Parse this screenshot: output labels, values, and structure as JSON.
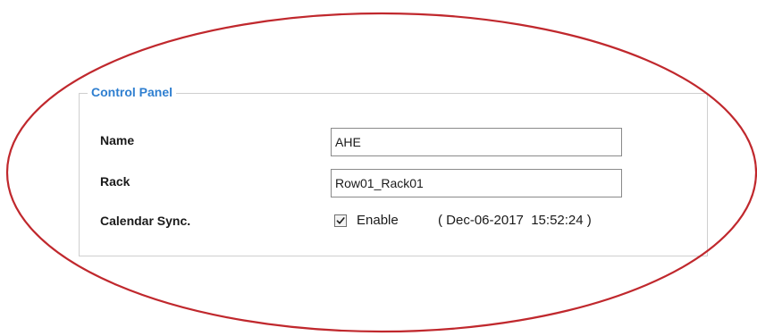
{
  "panel": {
    "legend": "Control Panel",
    "fields": [
      {
        "label": "Name",
        "value": "AHE"
      },
      {
        "label": "Rack",
        "value": "Row01_Rack01"
      }
    ],
    "calendar_sync": {
      "label": "Calendar Sync.",
      "checkbox_checked": true,
      "checkbox_label": "Enable",
      "timestamp": "( Dec-06-2017  15:52:24 )"
    }
  },
  "annotation": {
    "color": "#c0282d",
    "shape": "ellipse"
  }
}
